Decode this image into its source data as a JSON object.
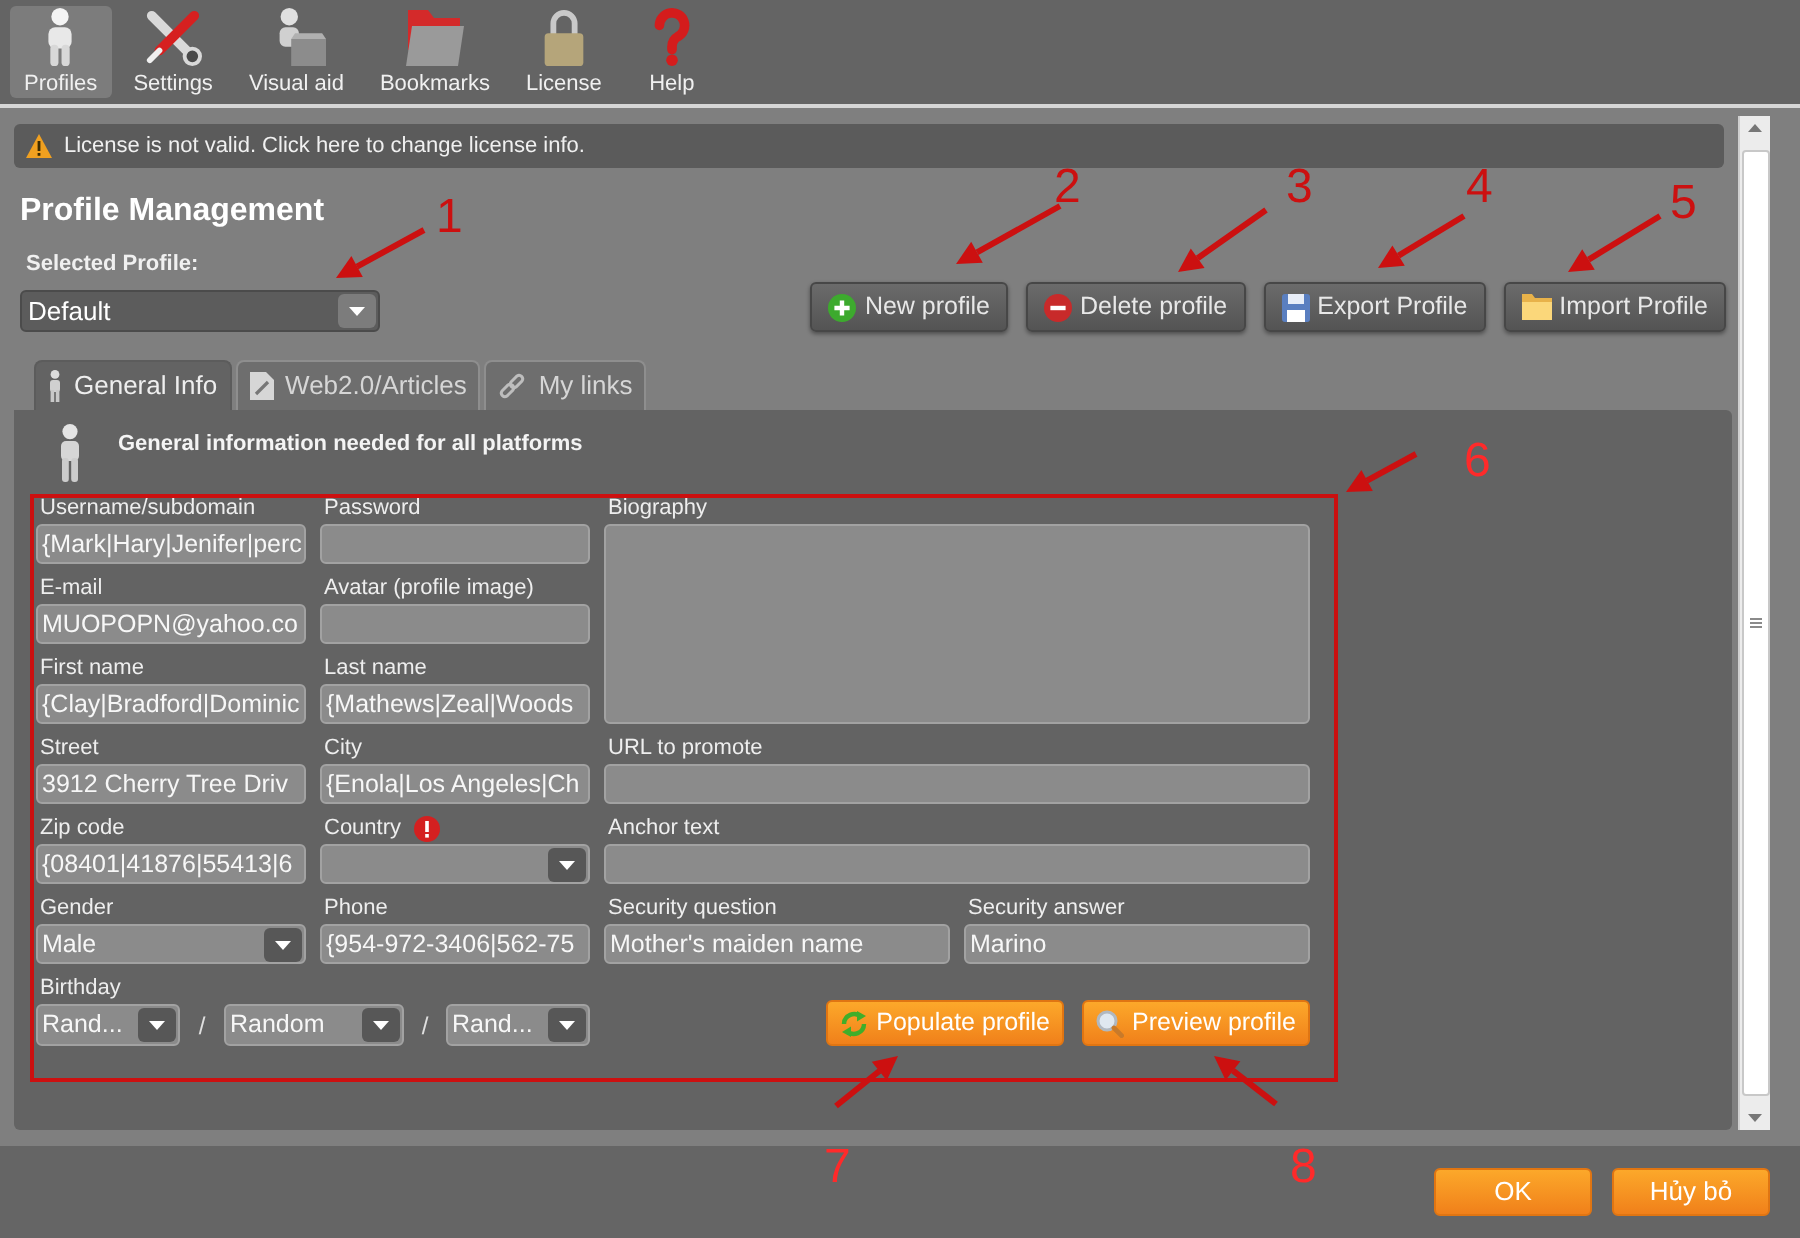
{
  "toolbar": {
    "items": [
      {
        "label": "Profiles",
        "selected": true
      },
      {
        "label": "Settings",
        "selected": false
      },
      {
        "label": "Visual aid",
        "selected": false
      },
      {
        "label": "Bookmarks",
        "selected": false
      },
      {
        "label": "License",
        "selected": false
      },
      {
        "label": "Help",
        "selected": false
      }
    ]
  },
  "license_notice": {
    "text": "License is not valid. Click here to change license info."
  },
  "profile_management": {
    "title": "Profile Management",
    "selected_profile": {
      "label": "Selected Profile:",
      "value": "Default"
    },
    "buttons": [
      {
        "label": "New profile"
      },
      {
        "label": "Delete profile"
      },
      {
        "label": "Export Profile"
      },
      {
        "label": "Import Profile"
      }
    ]
  },
  "tabs": [
    {
      "label": "General Info",
      "selected": true
    },
    {
      "label": "Web2.0/Articles",
      "selected": false
    },
    {
      "label": "My links",
      "selected": false
    }
  ],
  "general_info": {
    "heading": "General information needed for all platforms",
    "column_1": [
      {
        "label": "Username/subdomain",
        "kind": "text",
        "value": "{Mark|Hary|Jenifer|perc"
      },
      {
        "label": "E-mail",
        "kind": "text",
        "value": "MUOPOPN@yahoo.co"
      },
      {
        "label": "First name",
        "kind": "text",
        "value": "{Clay|Bradford|Dominic"
      },
      {
        "label": "Street",
        "kind": "text",
        "value": "3912 Cherry Tree Driv"
      },
      {
        "label": "Zip code",
        "kind": "text",
        "value": "{08401|41876|55413|6"
      },
      {
        "label": "Gender",
        "kind": "select",
        "value": "Male"
      }
    ],
    "column_2": [
      {
        "label": "Password",
        "kind": "text"
      },
      {
        "label": "Avatar (profile image)",
        "kind": "text"
      },
      {
        "label": "Last name",
        "kind": "text",
        "value": "{Mathews|Zeal|Woods"
      },
      {
        "label": "City",
        "kind": "text",
        "value": "{Enola|Los Angeles|Ch"
      },
      {
        "label": "Country",
        "kind": "select",
        "required_warning": true
      },
      {
        "label": "Phone",
        "kind": "text",
        "value": "{954-972-3406|562-75"
      }
    ],
    "column_3": [
      {
        "label": "Biography",
        "kind": "textarea"
      },
      {
        "label": "URL to promote",
        "kind": "text"
      },
      {
        "label": "Anchor text",
        "kind": "text"
      }
    ],
    "security": [
      {
        "label": "Security question",
        "kind": "text",
        "value": "Mother's maiden name"
      },
      {
        "label": "Security answer",
        "kind": "text",
        "value": "Marino"
      }
    ],
    "birthday": {
      "label": "Birthday",
      "selects": [
        {
          "value": "Rand..."
        },
        {
          "value": "Random"
        },
        {
          "value": "Rand..."
        }
      ],
      "separators": [
        "/",
        "/"
      ]
    },
    "actions": [
      {
        "label": "Populate profile"
      },
      {
        "label": "Preview profile"
      }
    ]
  },
  "dialog_buttons": [
    {
      "label": "OK"
    },
    {
      "label": "Hủy bỏ"
    }
  ],
  "annotations": [
    {
      "number": "1"
    },
    {
      "number": "2"
    },
    {
      "number": "3"
    },
    {
      "number": "4"
    },
    {
      "number": "5"
    },
    {
      "number": "6"
    },
    {
      "number": "7"
    },
    {
      "number": "8"
    }
  ]
}
